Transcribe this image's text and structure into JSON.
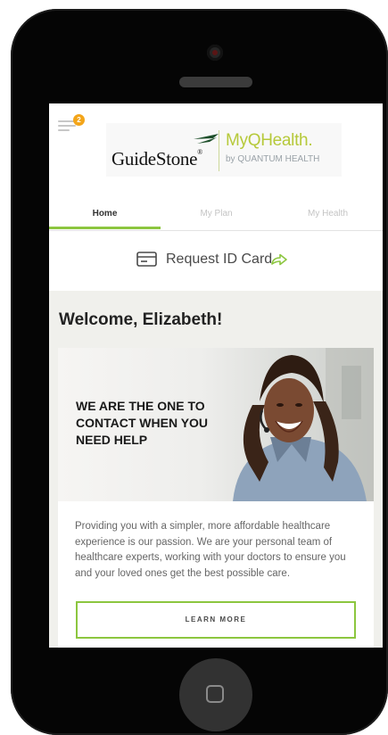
{
  "header": {
    "notification_count": "2",
    "logo": {
      "brand_left": "GuideStone",
      "brand_left_mark": "®",
      "brand_right": "MyQHealth.",
      "brand_right_sub": "by QUANTUM HEALTH"
    }
  },
  "tabs": [
    {
      "label": "Home",
      "active": true
    },
    {
      "label": "My Plan",
      "active": false
    },
    {
      "label": "My Health",
      "active": false
    }
  ],
  "request_id": {
    "label": "Request ID Card"
  },
  "welcome": "Welcome, Elizabeth!",
  "promo": {
    "headline": "WE ARE THE ONE TO CONTACT WHEN YOU NEED HELP",
    "body": "Providing you with a simpler, more affordable healthcare experience is our passion. We are your personal team of healthcare experts, working with your doctors to ensure you and your loved ones get the best possible care.",
    "button_label": "LEARN MORE"
  },
  "colors": {
    "accent_green": "#8cc63f",
    "brand_lime": "#b6c93a",
    "badge_orange": "#f3a51a",
    "content_background": "#f0f0ec"
  },
  "icons": {
    "menu": "hamburger-menu-icon",
    "id_card": "id-card-icon",
    "share": "share-arrow-icon",
    "logo_mark": "guidestone-wings-icon"
  }
}
